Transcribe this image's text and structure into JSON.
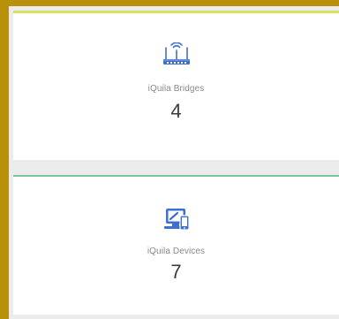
{
  "colors": {
    "frame": "#b8900a",
    "bridges_accent": "#d6e35a",
    "devices_accent": "#7fc58f",
    "icon": "#3f6fd1",
    "background": "#ececec"
  },
  "cards": [
    {
      "icon": "router-icon",
      "label": "iQuila Bridges",
      "count": "4"
    },
    {
      "icon": "devices-icon",
      "label": "iQuila Devices",
      "count": "7"
    }
  ]
}
